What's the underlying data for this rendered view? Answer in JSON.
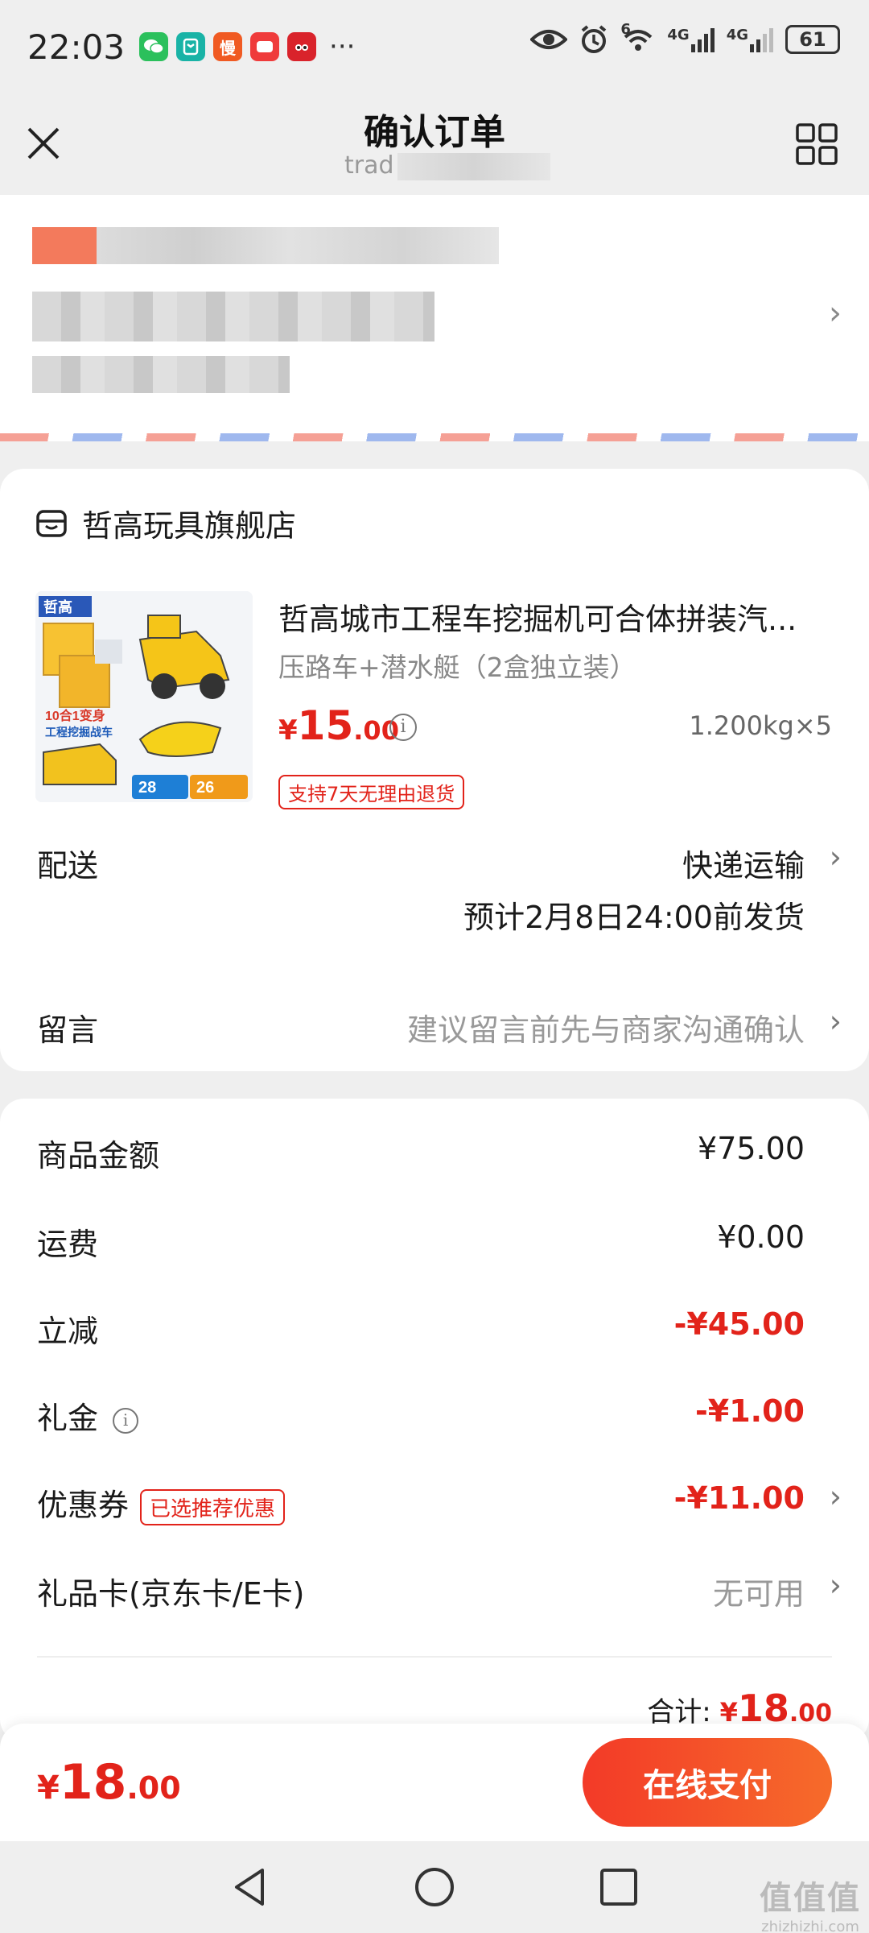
{
  "status_bar": {
    "time": "22:03",
    "more": "···",
    "signal_1": "4G",
    "signal_2": "4G",
    "wifi_sup": "6",
    "battery": "61",
    "apps": [
      {
        "name": "wechat-icon",
        "color": "#2bc05c"
      },
      {
        "name": "mi-icon",
        "color": "#19b3a6"
      },
      {
        "name": "man-icon",
        "color": "#f05a22",
        "glyph": "慢"
      },
      {
        "name": "red-app-icon",
        "color": "#ef3b3b"
      },
      {
        "name": "tmall-icon",
        "color": "#d9232b"
      }
    ]
  },
  "nav": {
    "title": "确认订单",
    "subtitle": "trad"
  },
  "shop": {
    "name": "哲高玩具旗舰店"
  },
  "product": {
    "title": "哲高城市工程车挖掘机可合体拼装汽...",
    "spec": "压路车+潜水艇（2盒独立装）",
    "price_symbol": "¥",
    "price_int": "15",
    "price_dec": ".00",
    "info_glyph": "i",
    "weight": "1.200kg×5",
    "return_policy": "支持7天无理由退货",
    "image_texts": {
      "brand": "哲高",
      "promo": "10合1变身",
      "promo_sub": "工程挖掘战车",
      "count_a": "28",
      "count_b": "26"
    }
  },
  "delivery": {
    "label": "配送",
    "method": "快递运输",
    "estimate": "预计2月8日24:00前发货"
  },
  "message": {
    "label": "留言",
    "placeholder": "建议留言前先与商家沟通确认"
  },
  "summary": {
    "items": [
      {
        "label": "商品金额",
        "value": "¥75.00"
      },
      {
        "label": "运费",
        "value": "¥0.00"
      },
      {
        "label": "立减",
        "value": "-¥45.00"
      },
      {
        "label": "礼金",
        "value": "-¥1.00"
      },
      {
        "label": "优惠券",
        "value": "-¥11.00",
        "badge": "已选推荐优惠"
      },
      {
        "label": "礼品卡(京东卡/E卡)",
        "value": "无可用"
      }
    ],
    "total_label": "合计:",
    "total_symbol": "¥",
    "total_int": "18",
    "total_dec": ".00"
  },
  "bottom_bar": {
    "pay_symbol": "¥",
    "pay_int": "18",
    "pay_dec": ".00",
    "pay_button": "在线支付"
  },
  "watermark": {
    "line1": "值值值",
    "line2": "zhizhizhi.com"
  },
  "colors": {
    "accent_red": "#e2231a",
    "pay_gradient_start": "#f33a28",
    "pay_gradient_end": "#f66b2a"
  }
}
